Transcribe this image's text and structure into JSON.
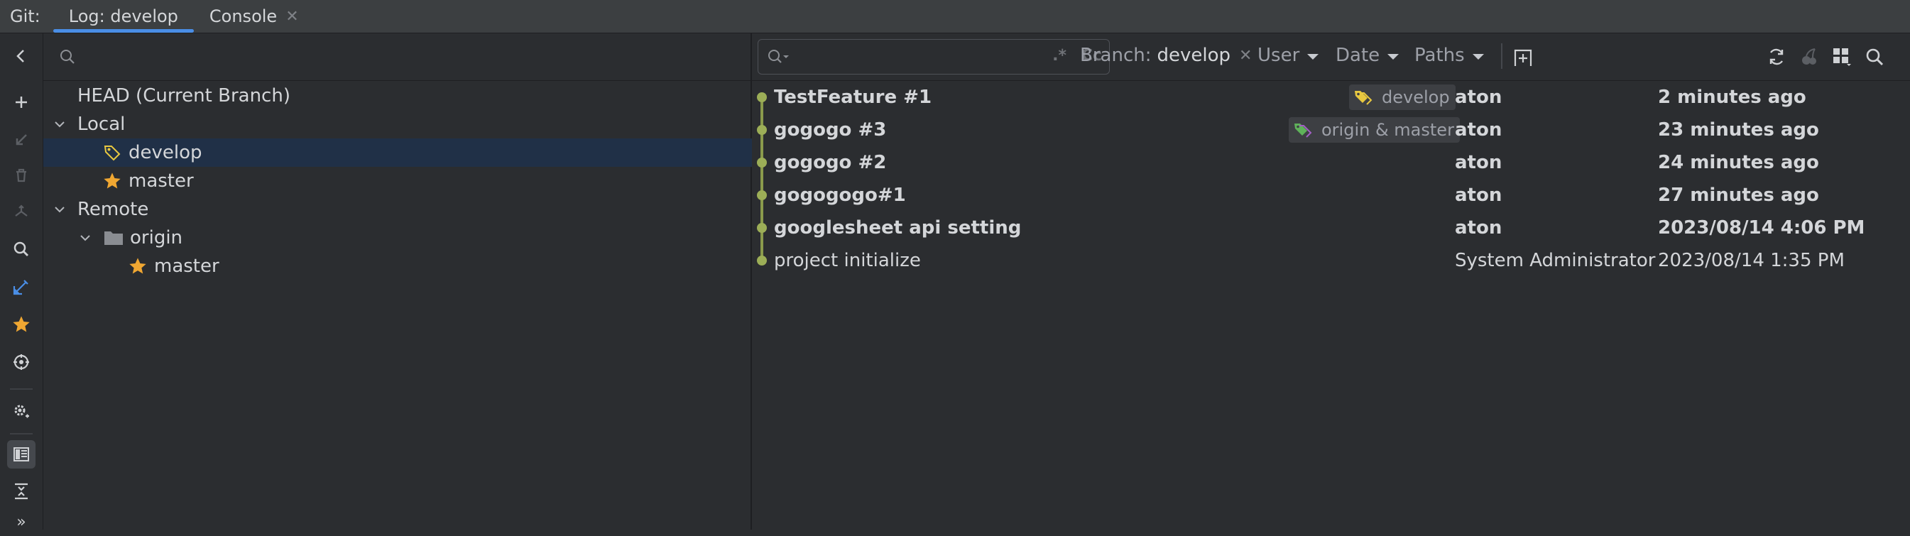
{
  "tabbar": {
    "prefix": "Git:",
    "tabs": [
      {
        "label": "Log: develop",
        "active": true
      },
      {
        "label": "Console",
        "closable": true
      }
    ],
    "close_glyph": "✕"
  },
  "left_toolbar": {
    "icons": [
      "collapse-left-icon",
      "add-icon",
      "checkout-icon",
      "delete-icon",
      "merge-icon",
      "search-icon",
      "edit-icon",
      "star-icon",
      "crosshair-icon",
      "settings-icon",
      "branches-panel-icon",
      "expand-collapse-icon",
      "more-icon"
    ],
    "more_glyph": "»"
  },
  "branches": {
    "search": {
      "placeholder": "",
      "value": ""
    },
    "head": "HEAD (Current Branch)",
    "local": {
      "label": "Local",
      "items": [
        {
          "name": "develop",
          "icon": "tag-icon",
          "selected": true
        },
        {
          "name": "master",
          "icon": "star-icon"
        }
      ]
    },
    "remote": {
      "label": "Remote",
      "origin": {
        "label": "origin",
        "items": [
          {
            "name": "master",
            "icon": "star-icon"
          }
        ]
      }
    }
  },
  "log_toolbar": {
    "text_filter": {
      "value": "",
      "regex_glyph": ".*",
      "case_glyph": "Cc"
    },
    "branch_filter": {
      "label": "Branch:",
      "value": "develop"
    },
    "user_filter": {
      "label": "User"
    },
    "date_filter": {
      "label": "Date"
    },
    "paths_filter": {
      "label": "Paths"
    },
    "close_glyph": "✕"
  },
  "commits": [
    {
      "subject": "TestFeature #1",
      "author": "aton",
      "date": "2 minutes ago",
      "bold": true,
      "ref": "develop",
      "ref_icon_color": "#e8c840"
    },
    {
      "subject": "gogogo #3",
      "author": "aton",
      "date": "23 minutes ago",
      "bold": true,
      "ref": "origin & master",
      "ref_icon_color": "#5fb25a"
    },
    {
      "subject": "gogogo #2",
      "author": "aton",
      "date": "24 minutes ago",
      "bold": true
    },
    {
      "subject": "gogogogo#1",
      "author": "aton",
      "date": "27 minutes ago",
      "bold": true
    },
    {
      "subject": "googlesheet api setting",
      "author": "aton",
      "date": "2023/08/14 4:06 PM",
      "bold": true
    },
    {
      "subject": "project initialize",
      "author": "System Administrator",
      "date": "2023/08/14 1:35 PM",
      "bold": false
    }
  ],
  "colors": {
    "accent": "#4a8ee6",
    "selection": "#203047",
    "graph": "#9cae57",
    "star": "#f0a732",
    "tag": "#e8c840"
  }
}
